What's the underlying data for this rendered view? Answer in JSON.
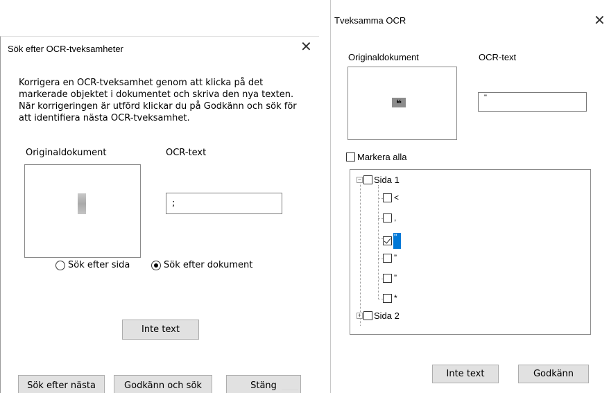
{
  "left_dialog": {
    "title": "Sök efter OCR-tveksamheter",
    "instructions": "Korrigera en OCR-tveksamhet genom att klicka på det markerade objektet i dokumentet och skriva den nya texten. När korrigeringen är utförd klickar du på Godkänn och sök för att identifiera nästa OCR-tveksamhet.",
    "label_original": "Originaldokument",
    "label_ocr": "OCR-text",
    "ocr_value": ";",
    "radio_page": "Sök efter sida",
    "radio_document": "Sök efter dokument",
    "radio_selected": "document",
    "button_not_text": "Inte text",
    "button_search_next": "Sök efter nästa",
    "button_approve_search": "Godkänn och sök",
    "button_close": "Stäng",
    "close_glyph": "✕"
  },
  "right_dialog": {
    "title": "Tveksamma OCR",
    "label_original": "Originaldokument",
    "label_ocr": "OCR-text",
    "preview_glyph": "❝",
    "ocr_value": "\"",
    "select_all": "Markera alla",
    "tree": {
      "page1": "Sida 1",
      "page2": "Sida 2",
      "leaves": [
        "<",
        ",",
        "\"",
        "”",
        "”",
        "*"
      ],
      "selected_index": 2
    },
    "button_not_text": "Inte text",
    "button_approve": "Godkänn",
    "close_glyph": "✕"
  },
  "colors": {
    "selection": "#0078d7",
    "button_bg": "#e1e1e1"
  }
}
